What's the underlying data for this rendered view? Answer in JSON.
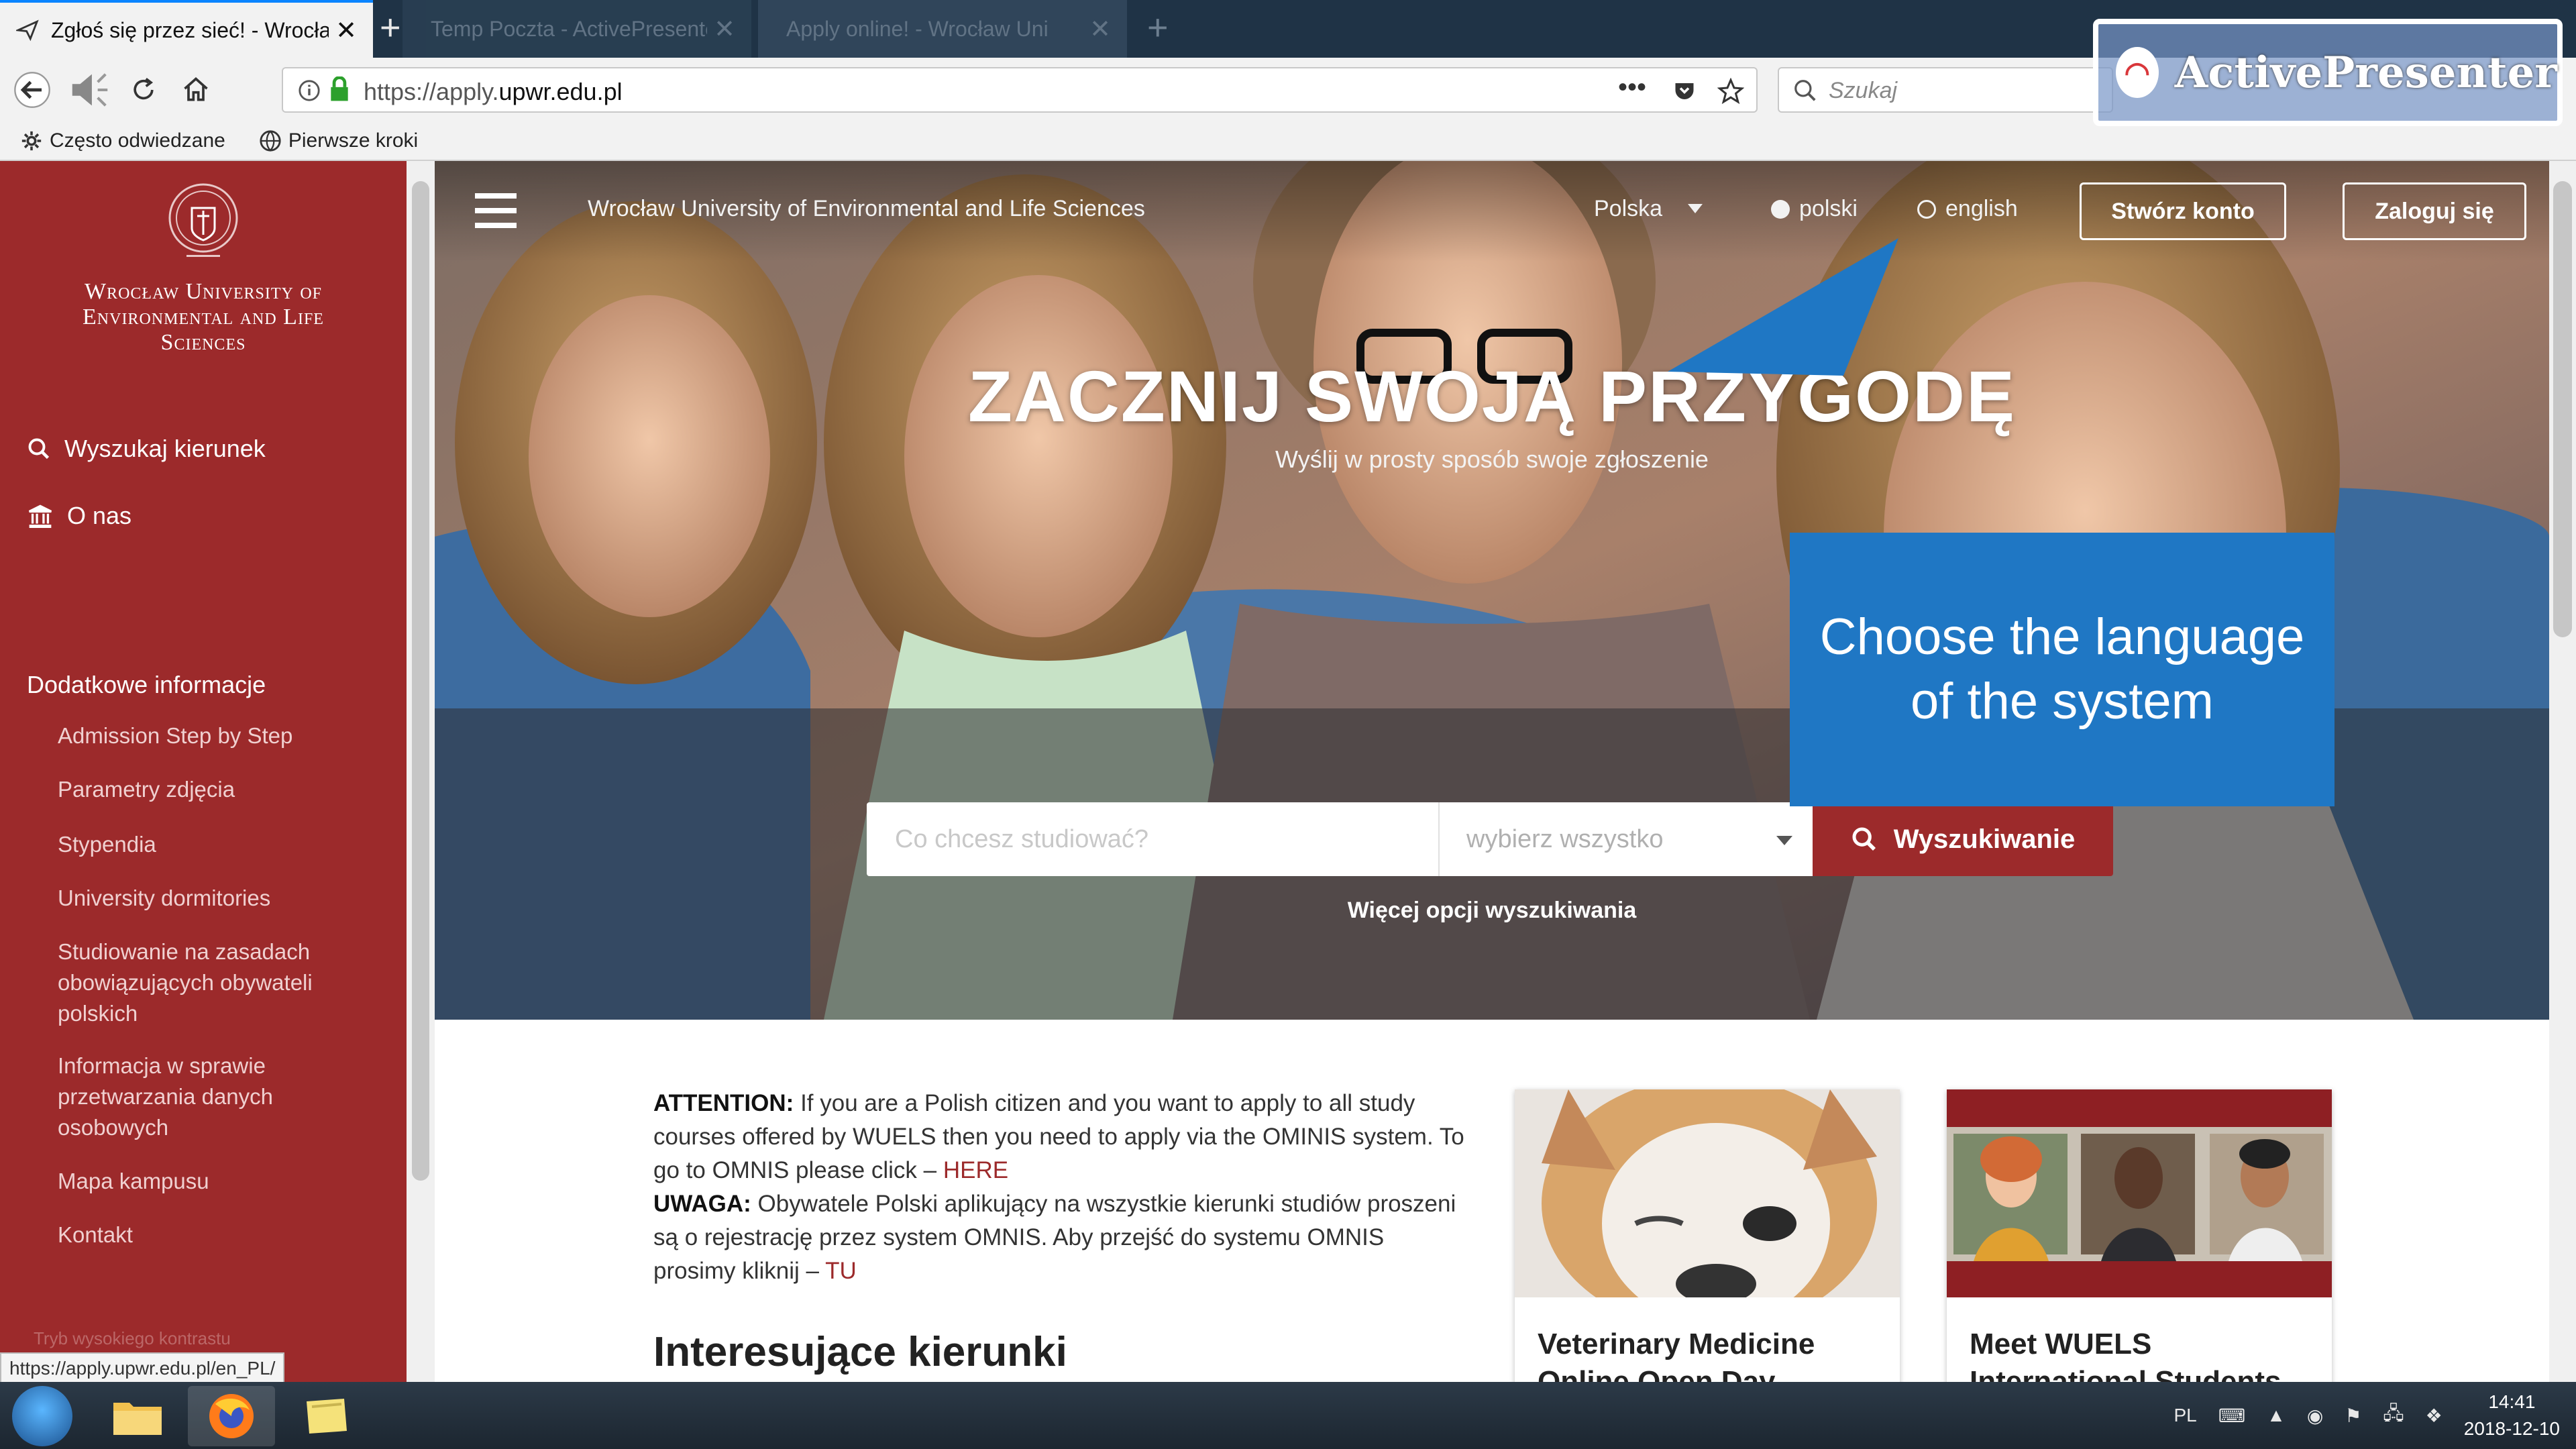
{
  "browser": {
    "tabs": [
      {
        "title": "Zgłoś się przez sieć! - Wrocław",
        "active": true
      },
      {
        "title": "Temp Poczta - ActivePresenter",
        "active": false
      },
      {
        "title": "Apply online! - Wrocław Uni",
        "active": false
      }
    ],
    "url_prefix": "https://apply.",
    "url_domain": "upwr.edu.pl",
    "search_placeholder": "Szukaj",
    "bookmarks": [
      {
        "label": "Często odwiedzane",
        "icon": "gear-icon"
      },
      {
        "label": "Pierwsze kroki",
        "icon": "globe-icon"
      }
    ],
    "status_url": "https://apply.upwr.edu.pl/en_PL/"
  },
  "overlay": {
    "label": "ActivePresenter"
  },
  "sidebar": {
    "university_name": "Wrocław University of Environmental and Life Sciences",
    "main_links": [
      {
        "label": "Wyszukaj kierunek",
        "icon": "search-icon"
      },
      {
        "label": "O nas",
        "icon": "building-icon"
      }
    ],
    "section_heading": "Dodatkowe informacje",
    "sub_links": [
      "Admission Step by Step",
      "Parametry zdjęcia",
      "Stypendia",
      "University dormitories",
      "Studiowanie na zasadach obowiązujących obywateli polskich",
      "Informacja w sprawie przetwarzania danych osobowych",
      "Mapa kampusu",
      "Kontakt"
    ],
    "contrast_mode": "Tryb wysokiego kontrastu"
  },
  "header": {
    "site_title": "Wrocław University of Environmental and Life Sciences",
    "country": "Polska",
    "languages": [
      {
        "label": "polski",
        "selected": true
      },
      {
        "label": "english",
        "selected": false
      }
    ],
    "create_account": "Stwórz konto",
    "login": "Zaloguj się"
  },
  "hero": {
    "heading": "ZACZNIJ SWOJĄ PRZYGODĘ",
    "subheading": "Wyślij w prosty sposób swoje zgłoszenie",
    "search_placeholder": "Co chcesz studiować?",
    "select_value": "wybierz wszystko",
    "search_button": "Wyszukiwanie",
    "more_options": "Więcej opcji wyszukiwania"
  },
  "callout": {
    "text": "Choose the language of the system"
  },
  "content": {
    "attention_label": "ATTENTION:",
    "attention_text": "If you are a Polish citizen and you want to apply to all study courses offered by WUELS then you need to apply via the OMINIS system. To go to OMNIS please click –",
    "attention_link": "HERE",
    "uwaga_label": "UWAGA:",
    "uwaga_text": "Obywatele Polski aplikujący na wszystkie kierunki studiów proszeni są o rejestrację przez system OMNIS. Aby przejść do systemu OMNIS prosimy kliknij –",
    "uwaga_link": "TU",
    "interesting_heading": "Interesujące kierunki",
    "cards": [
      {
        "title": "Veterinary Medicine Online Open Day"
      },
      {
        "title": "Meet WUELS International Students"
      }
    ]
  },
  "taskbar": {
    "language": "PL",
    "time": "14:41",
    "date": "2018-12-10"
  },
  "colors": {
    "brand_red": "#9c2a2b",
    "callout_blue": "#1f77c4",
    "tab_accent": "#0a84ff"
  }
}
